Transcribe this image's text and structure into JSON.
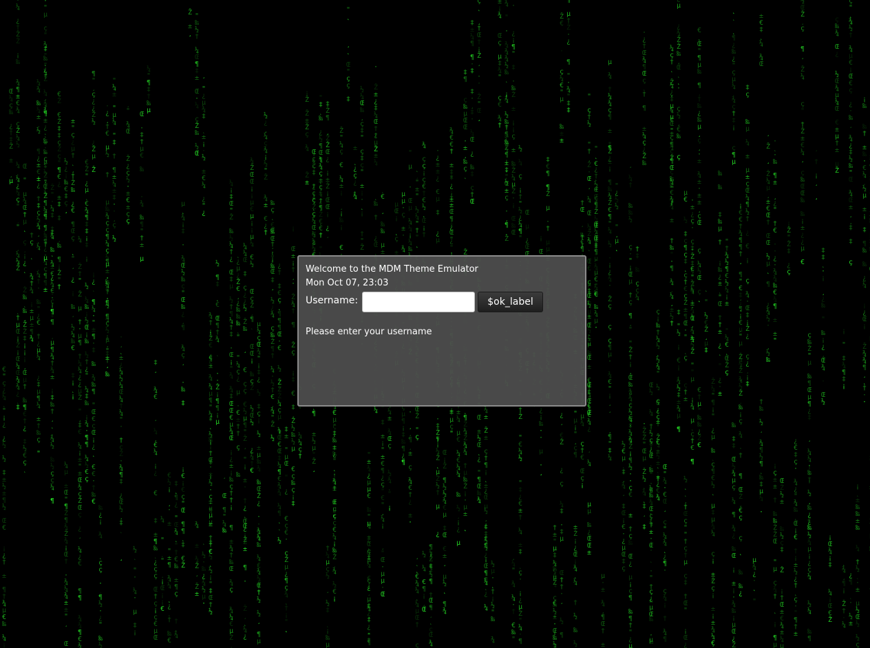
{
  "background": {
    "theme": "matrix-rain",
    "glyph_color": "#22cc22",
    "base_color": "#000000"
  },
  "login": {
    "welcome": "Welcome to the MDM Theme Emulator",
    "clock": "Mon Oct 07, 23:03",
    "username_label": "Username:",
    "username_value": "",
    "ok_label": "$ok_label",
    "message": "Please enter your username"
  }
}
